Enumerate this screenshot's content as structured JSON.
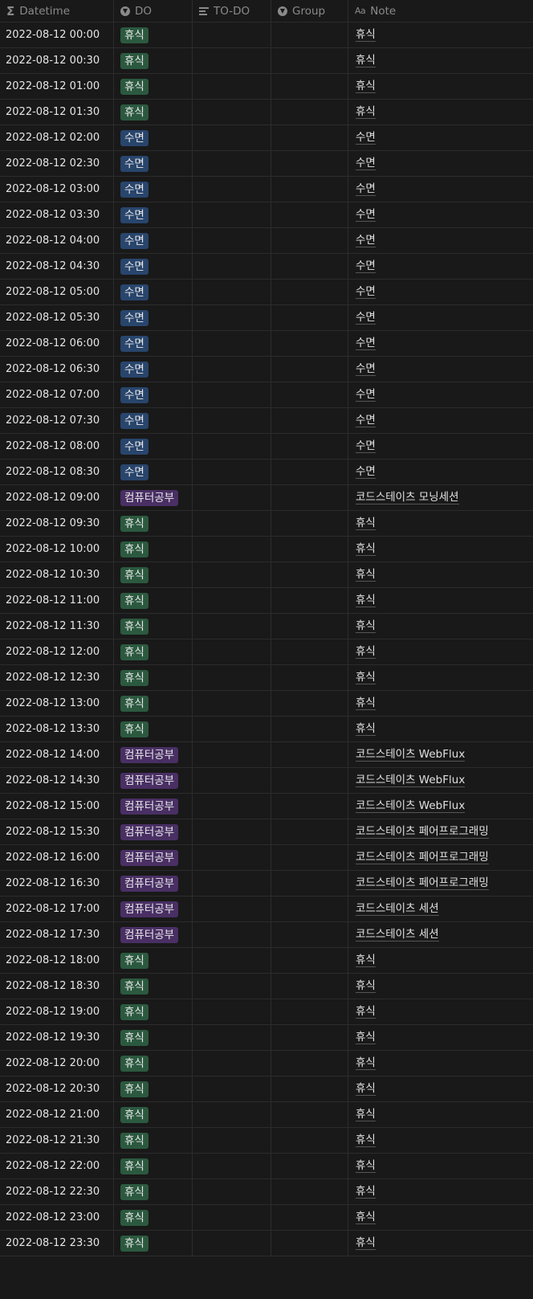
{
  "headers": {
    "datetime": "Datetime",
    "do": "DO",
    "todo": "TO-DO",
    "group": "Group",
    "note": "Note"
  },
  "tag_colors": {
    "휴식": "#2b593f",
    "수면": "#28456c",
    "컴퓨터공부": "#492f64"
  },
  "rows": [
    {
      "datetime": "2022-08-12 00:00",
      "do": "휴식",
      "note": "휴식"
    },
    {
      "datetime": "2022-08-12 00:30",
      "do": "휴식",
      "note": "휴식"
    },
    {
      "datetime": "2022-08-12 01:00",
      "do": "휴식",
      "note": "휴식"
    },
    {
      "datetime": "2022-08-12 01:30",
      "do": "휴식",
      "note": "휴식"
    },
    {
      "datetime": "2022-08-12 02:00",
      "do": "수면",
      "note": "수면"
    },
    {
      "datetime": "2022-08-12 02:30",
      "do": "수면",
      "note": "수면"
    },
    {
      "datetime": "2022-08-12 03:00",
      "do": "수면",
      "note": "수면"
    },
    {
      "datetime": "2022-08-12 03:30",
      "do": "수면",
      "note": "수면"
    },
    {
      "datetime": "2022-08-12 04:00",
      "do": "수면",
      "note": "수면"
    },
    {
      "datetime": "2022-08-12 04:30",
      "do": "수면",
      "note": "수면"
    },
    {
      "datetime": "2022-08-12 05:00",
      "do": "수면",
      "note": "수면"
    },
    {
      "datetime": "2022-08-12 05:30",
      "do": "수면",
      "note": "수면"
    },
    {
      "datetime": "2022-08-12 06:00",
      "do": "수면",
      "note": "수면"
    },
    {
      "datetime": "2022-08-12 06:30",
      "do": "수면",
      "note": "수면"
    },
    {
      "datetime": "2022-08-12 07:00",
      "do": "수면",
      "note": "수면"
    },
    {
      "datetime": "2022-08-12 07:30",
      "do": "수면",
      "note": "수면"
    },
    {
      "datetime": "2022-08-12 08:00",
      "do": "수면",
      "note": "수면"
    },
    {
      "datetime": "2022-08-12 08:30",
      "do": "수면",
      "note": "수면"
    },
    {
      "datetime": "2022-08-12 09:00",
      "do": "컴퓨터공부",
      "note": "코드스테이츠 모닝세션"
    },
    {
      "datetime": "2022-08-12 09:30",
      "do": "휴식",
      "note": "휴식"
    },
    {
      "datetime": "2022-08-12 10:00",
      "do": "휴식",
      "note": "휴식"
    },
    {
      "datetime": "2022-08-12 10:30",
      "do": "휴식",
      "note": "휴식"
    },
    {
      "datetime": "2022-08-12 11:00",
      "do": "휴식",
      "note": "휴식"
    },
    {
      "datetime": "2022-08-12 11:30",
      "do": "휴식",
      "note": "휴식"
    },
    {
      "datetime": "2022-08-12 12:00",
      "do": "휴식",
      "note": "휴식"
    },
    {
      "datetime": "2022-08-12 12:30",
      "do": "휴식",
      "note": "휴식"
    },
    {
      "datetime": "2022-08-12 13:00",
      "do": "휴식",
      "note": "휴식"
    },
    {
      "datetime": "2022-08-12 13:30",
      "do": "휴식",
      "note": "휴식"
    },
    {
      "datetime": "2022-08-12 14:00",
      "do": "컴퓨터공부",
      "note": "코드스테이츠 WebFlux"
    },
    {
      "datetime": "2022-08-12 14:30",
      "do": "컴퓨터공부",
      "note": "코드스테이츠 WebFlux"
    },
    {
      "datetime": "2022-08-12 15:00",
      "do": "컴퓨터공부",
      "note": "코드스테이츠 WebFlux"
    },
    {
      "datetime": "2022-08-12 15:30",
      "do": "컴퓨터공부",
      "note": "코드스테이츠 페어프로그래밍"
    },
    {
      "datetime": "2022-08-12 16:00",
      "do": "컴퓨터공부",
      "note": "코드스테이츠 페어프로그래밍"
    },
    {
      "datetime": "2022-08-12 16:30",
      "do": "컴퓨터공부",
      "note": "코드스테이츠 페어프로그래밍"
    },
    {
      "datetime": "2022-08-12 17:00",
      "do": "컴퓨터공부",
      "note": "코드스테이츠 세션"
    },
    {
      "datetime": "2022-08-12 17:30",
      "do": "컴퓨터공부",
      "note": "코드스테이츠 세션"
    },
    {
      "datetime": "2022-08-12 18:00",
      "do": "휴식",
      "note": "휴식"
    },
    {
      "datetime": "2022-08-12 18:30",
      "do": "휴식",
      "note": "휴식"
    },
    {
      "datetime": "2022-08-12 19:00",
      "do": "휴식",
      "note": "휴식"
    },
    {
      "datetime": "2022-08-12 19:30",
      "do": "휴식",
      "note": "휴식"
    },
    {
      "datetime": "2022-08-12 20:00",
      "do": "휴식",
      "note": "휴식"
    },
    {
      "datetime": "2022-08-12 20:30",
      "do": "휴식",
      "note": "휴식"
    },
    {
      "datetime": "2022-08-12 21:00",
      "do": "휴식",
      "note": "휴식"
    },
    {
      "datetime": "2022-08-12 21:30",
      "do": "휴식",
      "note": "휴식"
    },
    {
      "datetime": "2022-08-12 22:00",
      "do": "휴식",
      "note": "휴식"
    },
    {
      "datetime": "2022-08-12 22:30",
      "do": "휴식",
      "note": "휴식"
    },
    {
      "datetime": "2022-08-12 23:00",
      "do": "휴식",
      "note": "휴식"
    },
    {
      "datetime": "2022-08-12 23:30",
      "do": "휴식",
      "note": "휴식"
    }
  ]
}
